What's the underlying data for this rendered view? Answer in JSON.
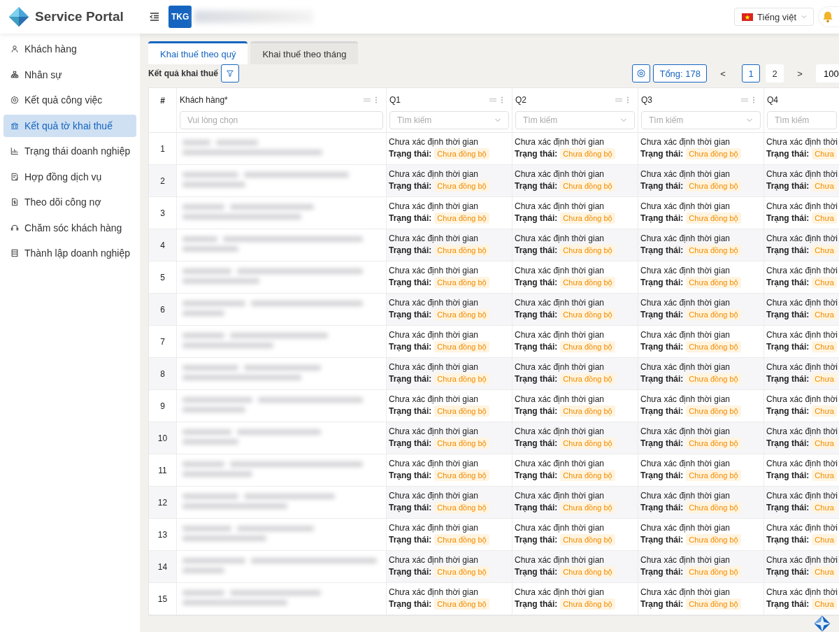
{
  "app": {
    "title": "Service Portal",
    "company_badge": "TKG",
    "language": "Tiếng việt"
  },
  "sidebar": {
    "items": [
      {
        "label": "Khách hàng",
        "selected": false
      },
      {
        "label": "Nhân sự",
        "selected": false
      },
      {
        "label": "Kết quả công việc",
        "selected": false
      },
      {
        "label": "Kết quả tờ khai thuế",
        "selected": true
      },
      {
        "label": "Trạng thái doanh nghiệp",
        "selected": false
      },
      {
        "label": "Hợp đồng dịch vụ",
        "selected": false
      },
      {
        "label": "Theo dõi công nợ",
        "selected": false
      },
      {
        "label": "Chăm sóc khách hàng",
        "selected": false
      },
      {
        "label": "Thành lập doanh nghiệp",
        "selected": false
      }
    ]
  },
  "tabs": [
    {
      "label": "Khai thuế theo quý",
      "selected": true
    },
    {
      "label": "Khai thuế theo tháng",
      "selected": false
    }
  ],
  "toolbar": {
    "title": "Kết quả khai thuế",
    "total": "Tổng: 178",
    "prev": "<",
    "next": ">",
    "pages": [
      {
        "label": "1",
        "selected": true
      },
      {
        "label": "2",
        "selected": false
      }
    ],
    "page_size": "100"
  },
  "table": {
    "columns": [
      {
        "label": "#",
        "kind": "index"
      },
      {
        "label": "Khách hàng*",
        "kind": "customer",
        "placeholder": "Vui lòng chọn"
      },
      {
        "label": "Q1",
        "kind": "quarter",
        "placeholder": "Tìm kiếm"
      },
      {
        "label": "Q2",
        "kind": "quarter",
        "placeholder": "Tìm kiếm"
      },
      {
        "label": "Q3",
        "kind": "quarter",
        "placeholder": "Tìm kiếm"
      },
      {
        "label": "Q4",
        "kind": "quarter",
        "placeholder": "Tìm kiếm"
      }
    ],
    "rows": [
      {
        "cells": [
          {
            "kind": "index",
            "text": "1"
          },
          {
            "kind": "redacted"
          },
          {
            "kind": "status",
            "time": "Chưa xác định thời gian",
            "label": "Trạng thái:",
            "status": "Chưa đồng bộ"
          },
          {
            "kind": "status",
            "time": "Chưa xác định thời gian",
            "label": "Trạng thái:",
            "status": "Chưa đồng bộ"
          },
          {
            "kind": "status",
            "time": "Chưa xác định thời gian",
            "label": "Trạng thái:",
            "status": "Chưa đồng bộ"
          },
          {
            "kind": "status",
            "time": "Chưa xác định thời",
            "label": "Trạng thái:",
            "status": "Chưa"
          }
        ]
      },
      {
        "cells": [
          {
            "kind": "index",
            "text": "2"
          },
          {
            "kind": "redacted"
          },
          {
            "kind": "status",
            "time": "Chưa xác định thời gian",
            "label": "Trạng thái:",
            "status": "Chưa đồng bộ"
          },
          {
            "kind": "status",
            "time": "Chưa xác định thời gian",
            "label": "Trạng thái:",
            "status": "Chưa đồng bộ"
          },
          {
            "kind": "status",
            "time": "Chưa xác định thời gian",
            "label": "Trạng thái:",
            "status": "Chưa đồng bộ"
          },
          {
            "kind": "status",
            "time": "Chưa xác định thời",
            "label": "Trạng thái:",
            "status": "Chưa"
          }
        ]
      },
      {
        "cells": [
          {
            "kind": "index",
            "text": "3"
          },
          {
            "kind": "redacted"
          },
          {
            "kind": "status",
            "time": "Chưa xác định thời gian",
            "label": "Trạng thái:",
            "status": "Chưa đồng bộ"
          },
          {
            "kind": "status",
            "time": "Chưa xác định thời gian",
            "label": "Trạng thái:",
            "status": "Chưa đồng bộ"
          },
          {
            "kind": "status",
            "time": "Chưa xác định thời gian",
            "label": "Trạng thái:",
            "status": "Chưa đồng bộ"
          },
          {
            "kind": "status",
            "time": "Chưa xác định thời",
            "label": "Trạng thái:",
            "status": "Chưa"
          }
        ]
      },
      {
        "cells": [
          {
            "kind": "index",
            "text": "4"
          },
          {
            "kind": "redacted"
          },
          {
            "kind": "status",
            "time": "Chưa xác định thời gian",
            "label": "Trạng thái:",
            "status": "Chưa đồng bộ"
          },
          {
            "kind": "status",
            "time": "Chưa xác định thời gian",
            "label": "Trạng thái:",
            "status": "Chưa đồng bộ"
          },
          {
            "kind": "status",
            "time": "Chưa xác định thời gian",
            "label": "Trạng thái:",
            "status": "Chưa đồng bộ"
          },
          {
            "kind": "status",
            "time": "Chưa xác định thời",
            "label": "Trạng thái:",
            "status": "Chưa"
          }
        ]
      },
      {
        "cells": [
          {
            "kind": "index",
            "text": "5"
          },
          {
            "kind": "redacted"
          },
          {
            "kind": "status",
            "time": "Chưa xác định thời gian",
            "label": "Trạng thái:",
            "status": "Chưa đồng bộ"
          },
          {
            "kind": "status",
            "time": "Chưa xác định thời gian",
            "label": "Trạng thái:",
            "status": "Chưa đồng bộ"
          },
          {
            "kind": "status",
            "time": "Chưa xác định thời gian",
            "label": "Trạng thái:",
            "status": "Chưa đồng bộ"
          },
          {
            "kind": "status",
            "time": "Chưa xác định thời",
            "label": "Trạng thái:",
            "status": "Chưa"
          }
        ]
      },
      {
        "cells": [
          {
            "kind": "index",
            "text": "6"
          },
          {
            "kind": "redacted"
          },
          {
            "kind": "status",
            "time": "Chưa xác định thời gian",
            "label": "Trạng thái:",
            "status": "Chưa đồng bộ"
          },
          {
            "kind": "status",
            "time": "Chưa xác định thời gian",
            "label": "Trạng thái:",
            "status": "Chưa đồng bộ"
          },
          {
            "kind": "status",
            "time": "Chưa xác định thời gian",
            "label": "Trạng thái:",
            "status": "Chưa đồng bộ"
          },
          {
            "kind": "status",
            "time": "Chưa xác định thời",
            "label": "Trạng thái:",
            "status": "Chưa"
          }
        ]
      },
      {
        "cells": [
          {
            "kind": "index",
            "text": "7"
          },
          {
            "kind": "redacted"
          },
          {
            "kind": "status",
            "time": "Chưa xác định thời gian",
            "label": "Trạng thái:",
            "status": "Chưa đồng bộ"
          },
          {
            "kind": "status",
            "time": "Chưa xác định thời gian",
            "label": "Trạng thái:",
            "status": "Chưa đồng bộ"
          },
          {
            "kind": "status",
            "time": "Chưa xác định thời gian",
            "label": "Trạng thái:",
            "status": "Chưa đồng bộ"
          },
          {
            "kind": "status",
            "time": "Chưa xác định thời",
            "label": "Trạng thái:",
            "status": "Chưa"
          }
        ]
      },
      {
        "cells": [
          {
            "kind": "index",
            "text": "8"
          },
          {
            "kind": "redacted"
          },
          {
            "kind": "status",
            "time": "Chưa xác định thời gian",
            "label": "Trạng thái:",
            "status": "Chưa đồng bộ"
          },
          {
            "kind": "status",
            "time": "Chưa xác định thời gian",
            "label": "Trạng thái:",
            "status": "Chưa đồng bộ"
          },
          {
            "kind": "status",
            "time": "Chưa xác định thời gian",
            "label": "Trạng thái:",
            "status": "Chưa đồng bộ"
          },
          {
            "kind": "status",
            "time": "Chưa xác định thời",
            "label": "Trạng thái:",
            "status": "Chưa"
          }
        ]
      },
      {
        "cells": [
          {
            "kind": "index",
            "text": "9"
          },
          {
            "kind": "redacted"
          },
          {
            "kind": "status",
            "time": "Chưa xác định thời gian",
            "label": "Trạng thái:",
            "status": "Chưa đồng bộ"
          },
          {
            "kind": "status",
            "time": "Chưa xác định thời gian",
            "label": "Trạng thái:",
            "status": "Chưa đồng bộ"
          },
          {
            "kind": "status",
            "time": "Chưa xác định thời gian",
            "label": "Trạng thái:",
            "status": "Chưa đồng bộ"
          },
          {
            "kind": "status",
            "time": "Chưa xác định thời",
            "label": "Trạng thái:",
            "status": "Chưa"
          }
        ]
      },
      {
        "cells": [
          {
            "kind": "index",
            "text": "10"
          },
          {
            "kind": "redacted"
          },
          {
            "kind": "status",
            "time": "Chưa xác định thời gian",
            "label": "Trạng thái:",
            "status": "Chưa đồng bộ"
          },
          {
            "kind": "status",
            "time": "Chưa xác định thời gian",
            "label": "Trạng thái:",
            "status": "Chưa đồng bộ"
          },
          {
            "kind": "status",
            "time": "Chưa xác định thời gian",
            "label": "Trạng thái:",
            "status": "Chưa đồng bộ"
          },
          {
            "kind": "status",
            "time": "Chưa xác định thời",
            "label": "Trạng thái:",
            "status": "Chưa"
          }
        ]
      },
      {
        "cells": [
          {
            "kind": "index",
            "text": "11"
          },
          {
            "kind": "redacted"
          },
          {
            "kind": "status",
            "time": "Chưa xác định thời gian",
            "label": "Trạng thái:",
            "status": "Chưa đồng bộ"
          },
          {
            "kind": "status",
            "time": "Chưa xác định thời gian",
            "label": "Trạng thái:",
            "status": "Chưa đồng bộ"
          },
          {
            "kind": "status",
            "time": "Chưa xác định thời gian",
            "label": "Trạng thái:",
            "status": "Chưa đồng bộ"
          },
          {
            "kind": "status",
            "time": "Chưa xác định thời",
            "label": "Trạng thái:",
            "status": "Chưa"
          }
        ]
      },
      {
        "cells": [
          {
            "kind": "index",
            "text": "12"
          },
          {
            "kind": "redacted"
          },
          {
            "kind": "status",
            "time": "Chưa xác định thời gian",
            "label": "Trạng thái:",
            "status": "Chưa đồng bộ"
          },
          {
            "kind": "status",
            "time": "Chưa xác định thời gian",
            "label": "Trạng thái:",
            "status": "Chưa đồng bộ"
          },
          {
            "kind": "status",
            "time": "Chưa xác định thời gian",
            "label": "Trạng thái:",
            "status": "Chưa đồng bộ"
          },
          {
            "kind": "status",
            "time": "Chưa xác định thời",
            "label": "Trạng thái:",
            "status": "Chưa"
          }
        ]
      },
      {
        "cells": [
          {
            "kind": "index",
            "text": "13"
          },
          {
            "kind": "redacted"
          },
          {
            "kind": "status",
            "time": "Chưa xác định thời gian",
            "label": "Trạng thái:",
            "status": "Chưa đồng bộ"
          },
          {
            "kind": "status",
            "time": "Chưa xác định thời gian",
            "label": "Trạng thái:",
            "status": "Chưa đồng bộ"
          },
          {
            "kind": "status",
            "time": "Chưa xác định thời gian",
            "label": "Trạng thái:",
            "status": "Chưa đồng bộ"
          },
          {
            "kind": "status",
            "time": "Chưa xác định thời",
            "label": "Trạng thái:",
            "status": "Chưa"
          }
        ]
      },
      {
        "cells": [
          {
            "kind": "index",
            "text": "14"
          },
          {
            "kind": "redacted"
          },
          {
            "kind": "status",
            "time": "Chưa xác định thời gian",
            "label": "Trạng thái:",
            "status": "Chưa đồng bộ"
          },
          {
            "kind": "status",
            "time": "Chưa xác định thời gian",
            "label": "Trạng thái:",
            "status": "Chưa đồng bộ"
          },
          {
            "kind": "status",
            "time": "Chưa xác định thời gian",
            "label": "Trạng thái:",
            "status": "Chưa đồng bộ"
          },
          {
            "kind": "status",
            "time": "Chưa xác định thời",
            "label": "Trạng thái:",
            "status": "Chưa"
          }
        ]
      },
      {
        "cells": [
          {
            "kind": "index",
            "text": "15"
          },
          {
            "kind": "redacted"
          },
          {
            "kind": "status",
            "time": "Chưa xác định thời gian",
            "label": "Trạng thái:",
            "status": "Chưa đồng bộ"
          },
          {
            "kind": "status",
            "time": "Chưa xác định thời gian",
            "label": "Trạng thái:",
            "status": "Chưa đồng bộ"
          },
          {
            "kind": "status",
            "time": "Chưa xác định thời gian",
            "label": "Trạng thái:",
            "status": "Chưa đồng bộ"
          },
          {
            "kind": "status",
            "time": "Chưa xác định thời",
            "label": "Trạng thái:",
            "status": "Chưa"
          }
        ]
      }
    ]
  }
}
